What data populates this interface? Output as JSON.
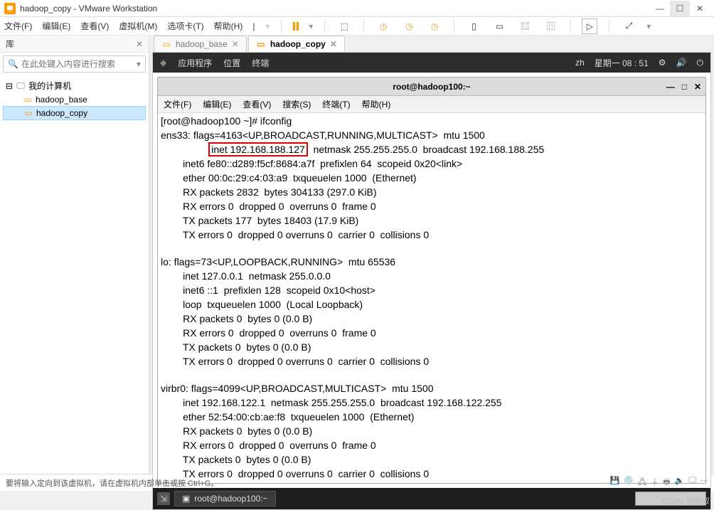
{
  "window": {
    "title": "hadoop_copy - VMware Workstation"
  },
  "menubar": {
    "file": "文件(F)",
    "edit": "编辑(E)",
    "view": "查看(V)",
    "vm": "虚拟机(M)",
    "tabs": "选项卡(T)",
    "help": "帮助(H)"
  },
  "sidebar": {
    "title": "库",
    "search_placeholder": "在此处键入内容进行搜索",
    "root": "我的计算机",
    "items": [
      "hadoop_base",
      "hadoop_copy"
    ]
  },
  "tabs": {
    "items": [
      {
        "label": "hadoop_base",
        "active": false
      },
      {
        "label": "hadoop_copy",
        "active": true
      }
    ]
  },
  "vm_topbar": {
    "apps": "应用程序",
    "places": "位置",
    "terminal": "终端",
    "lang": "zh",
    "clock": "星期一 08 : 51"
  },
  "termwin": {
    "title": "root@hadoop100:~",
    "menu": {
      "file": "文件(F)",
      "edit": "编辑(E)",
      "view": "查看(V)",
      "search": "搜索(S)",
      "terminal": "终端(T)",
      "help": "帮助(H)"
    }
  },
  "terminal": {
    "prompt": "[root@hadoop100 ~]# ifconfig",
    "ens33_1": "ens33: flags=4163<UP,BROADCAST,RUNNING,MULTICAST>  mtu 1500",
    "ens33_inet": "inet 192.168.188.127",
    "ens33_rest": "  netmask 255.255.255.0  broadcast 192.168.188.255",
    "ens33_3": "        inet6 fe80::d289:f5cf:8684:a7f  prefixlen 64  scopeid 0x20<link>",
    "ens33_4": "        ether 00:0c:29:c4:03:a9  txqueuelen 1000  (Ethernet)",
    "ens33_5": "        RX packets 2832  bytes 304133 (297.0 KiB)",
    "ens33_6": "        RX errors 0  dropped 0  overruns 0  frame 0",
    "ens33_7": "        TX packets 177  bytes 18403 (17.9 KiB)",
    "ens33_8": "        TX errors 0  dropped 0 overruns 0  carrier 0  collisions 0",
    "lo_1": "lo: flags=73<UP,LOOPBACK,RUNNING>  mtu 65536",
    "lo_2": "        inet 127.0.0.1  netmask 255.0.0.0",
    "lo_3": "        inet6 ::1  prefixlen 128  scopeid 0x10<host>",
    "lo_4": "        loop  txqueuelen 1000  (Local Loopback)",
    "lo_5": "        RX packets 0  bytes 0 (0.0 B)",
    "lo_6": "        RX errors 0  dropped 0  overruns 0  frame 0",
    "lo_7": "        TX packets 0  bytes 0 (0.0 B)",
    "lo_8": "        TX errors 0  dropped 0 overruns 0  carrier 0  collisions 0",
    "vb_1": "virbr0: flags=4099<UP,BROADCAST,MULTICAST>  mtu 1500",
    "vb_2": "        inet 192.168.122.1  netmask 255.255.255.0  broadcast 192.168.122.255",
    "vb_3": "        ether 52:54:00:cb:ae:f8  txqueuelen 1000  (Ethernet)",
    "vb_4": "        RX packets 0  bytes 0 (0.0 B)",
    "vb_5": "        RX errors 0  dropped 0  overruns 0  frame 0",
    "vb_6": "        TX packets 0  bytes 0 (0.0 B)",
    "vb_7": "        TX errors 0  dropped 0 overruns 0  carrier 0  collisions 0"
  },
  "taskbar": {
    "task1": "root@hadoop100:~"
  },
  "statusbar": {
    "hint": "要将输入定向到该虚拟机，请在虚拟机内部单击或按 Ctrl+G。"
  },
  "watermark": "CSDN @樹叙"
}
